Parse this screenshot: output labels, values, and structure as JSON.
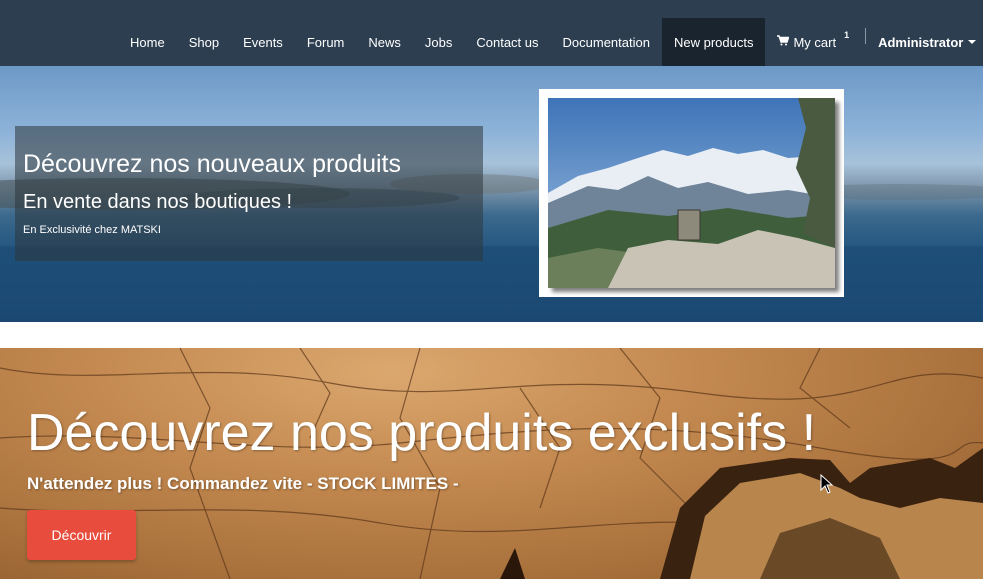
{
  "navbar": {
    "items": [
      {
        "label": "Home"
      },
      {
        "label": "Shop"
      },
      {
        "label": "Events"
      },
      {
        "label": "Forum"
      },
      {
        "label": "News"
      },
      {
        "label": "Jobs"
      },
      {
        "label": "Contact us"
      },
      {
        "label": "Documentation"
      },
      {
        "label": "New products",
        "active": true
      }
    ],
    "cart": {
      "label": "My cart",
      "count": "1",
      "icon": "shopping-cart-icon"
    },
    "user": {
      "label": "Administrator"
    },
    "colors": {
      "background": "#2c3e50",
      "active": "#1a242f"
    }
  },
  "hero1": {
    "title": "Découvrez nos nouveaux produits",
    "subtitle": "En vente dans nos boutiques !",
    "tagline": "En Exclusivité chez MATSKI"
  },
  "hero2": {
    "title": "Découvrez nos produits exclusifs !",
    "subtitle": "N'attendez plus ! Commandez vite - STOCK LIMITES -",
    "button_label": "Découvrir",
    "button_color": "#e74c3c"
  }
}
